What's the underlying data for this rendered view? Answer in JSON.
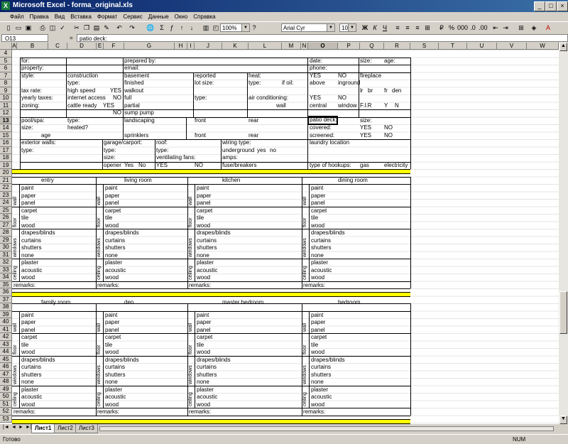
{
  "window": {
    "title": "Microsoft Excel - forma_original.xls",
    "icon": "excel-icon"
  },
  "menu": [
    "Файл",
    "Правка",
    "Вид",
    "Вставка",
    "Формат",
    "Сервис",
    "Данные",
    "Окно",
    "Справка"
  ],
  "toolbar": {
    "zoom": "100%",
    "font": "Arial Cyr",
    "size": "10"
  },
  "formula": {
    "name_box": "O13",
    "fx": "=",
    "value": "patio deck:"
  },
  "columns": [
    "A",
    "B",
    "C",
    "D",
    "E",
    "F",
    "G",
    "H",
    "I",
    "J",
    "K",
    "L",
    "M",
    "N",
    "O",
    "P",
    "Q",
    "R",
    "S",
    "T",
    "U",
    "V",
    "W"
  ],
  "rows": [
    "4",
    "5",
    "6",
    "7",
    "8",
    "9",
    "10",
    "11",
    "12",
    "13",
    "14",
    "15",
    "16",
    "17",
    "18",
    "19",
    "20",
    "21",
    "22",
    "23",
    "24",
    "25",
    "26",
    "27",
    "28",
    "29",
    "30",
    "31",
    "32",
    "33",
    "34",
    "35",
    "36",
    "37",
    "38",
    "39",
    "40",
    "41",
    "42",
    "43",
    "44",
    "45",
    "46",
    "47",
    "48",
    "49",
    "50",
    "51",
    "52",
    "53"
  ],
  "cells": {
    "r5a": "for:",
    "r5b": "prepared by:",
    "r5c": "date:",
    "r5d": "size:",
    "r5e": "age:",
    "r6a": "property:",
    "r6b": "email:",
    "r6c": "phone:",
    "r7a": "style:",
    "r7b": "construction",
    "r7c": "basement",
    "r7d": "reported",
    "r7e": "heat:",
    "r7f": "YES",
    "r7g": "NO",
    "r7h": "fireplace",
    "r8a": "type:",
    "r8b": "finished",
    "r8c": "lot size:",
    "r8d": "type:",
    "r8e": "if oil:",
    "r8f": "above",
    "r8g": "inground",
    "r9a": "tax rate:",
    "r9b": "high speed",
    "r9c": "YES",
    "r9d": "walkout",
    "r9e": "lr",
    "r9f": "br",
    "r9g": "fr",
    "r9h": "den",
    "r10a": "yearly taxes:",
    "r10b": "internet access",
    "r10c": "NO",
    "r10d": "full",
    "r10e": "type:",
    "r10f": "air conditioning:",
    "r10g": "YES",
    "r10h": "NO",
    "r11a": "zoning:",
    "r11b": "cattle ready",
    "r11c": "YES",
    "r11d": "partial",
    "r11e": "wall",
    "r11f": "central",
    "r11g": "window",
    "r11h": "F.I.R",
    "r11i": "Y",
    "r11j": "N",
    "r12a": "NO",
    "r12b": "sump pump",
    "r13a": "pool/spa:",
    "r13b": "type:",
    "r13c": "landscaping",
    "r13d": "front",
    "r13e": "rear",
    "r13f": "patio deck:",
    "r13g": "size:",
    "r14a": "size:",
    "r14b": "heated?",
    "r14c": "covered:",
    "r14d": "YES",
    "r14e": "NO",
    "r15a": "age",
    "r15b": "sprinklers",
    "r15c": "front",
    "r15d": "rear",
    "r15e": "screened:",
    "r15f": "YES",
    "r15g": "NO",
    "r16a": "exterior walls:",
    "r16b": "garage/carport:",
    "r16c": "roof:",
    "r16d": "wiring type:",
    "r16e": "laundry location",
    "r17a": "type:",
    "r17b": "type:",
    "r17c": "type:",
    "r17d": "underground",
    "r17e": "yes",
    "r17f": "no",
    "r18a": "size:",
    "r18b": "ventilating fans:",
    "r18c": "amps:",
    "r19a": "opener",
    "r19b": "Yes",
    "r19c": "No",
    "r19d": "YES",
    "r19e": "NO",
    "r19f": "fuse/breakers",
    "r19g": "type of hookups:",
    "r19h": "gas",
    "r19i": "electricity"
  },
  "rooms_top": [
    "entry",
    "living room",
    "kitchen",
    "dining room"
  ],
  "rooms_bottom": [
    "family room",
    "den",
    "master bedroom",
    "bedroom"
  ],
  "room_groups": [
    {
      "label": "wall",
      "items": [
        "paint",
        "paper",
        "panel"
      ]
    },
    {
      "label": "floor",
      "items": [
        "carpet",
        "tile",
        "wood"
      ]
    },
    {
      "label": "windows",
      "items": [
        "drapes/blinds",
        "curtains",
        "shutters",
        "none"
      ]
    },
    {
      "label": "ceiling",
      "items": [
        "plaster",
        "acoustic",
        "wood"
      ]
    }
  ],
  "remarks": "remarks:",
  "sheets": [
    "Лист1",
    "Лист2",
    "Лист3"
  ],
  "status": {
    "ready": "Готово",
    "num": "NUM"
  }
}
